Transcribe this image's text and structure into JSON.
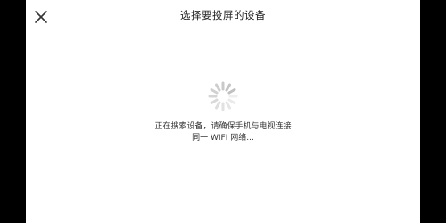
{
  "header": {
    "title": "选择要投屏的设备",
    "close_icon": "close-icon"
  },
  "status": {
    "line1": "正在搜索设备，请确保手机与电视连接",
    "line2": "同一 WIFI 网络..."
  },
  "colors": {
    "background": "#ffffff",
    "side_bars": "#000000",
    "text": "#222222",
    "spinner": "#bdbdbd"
  }
}
